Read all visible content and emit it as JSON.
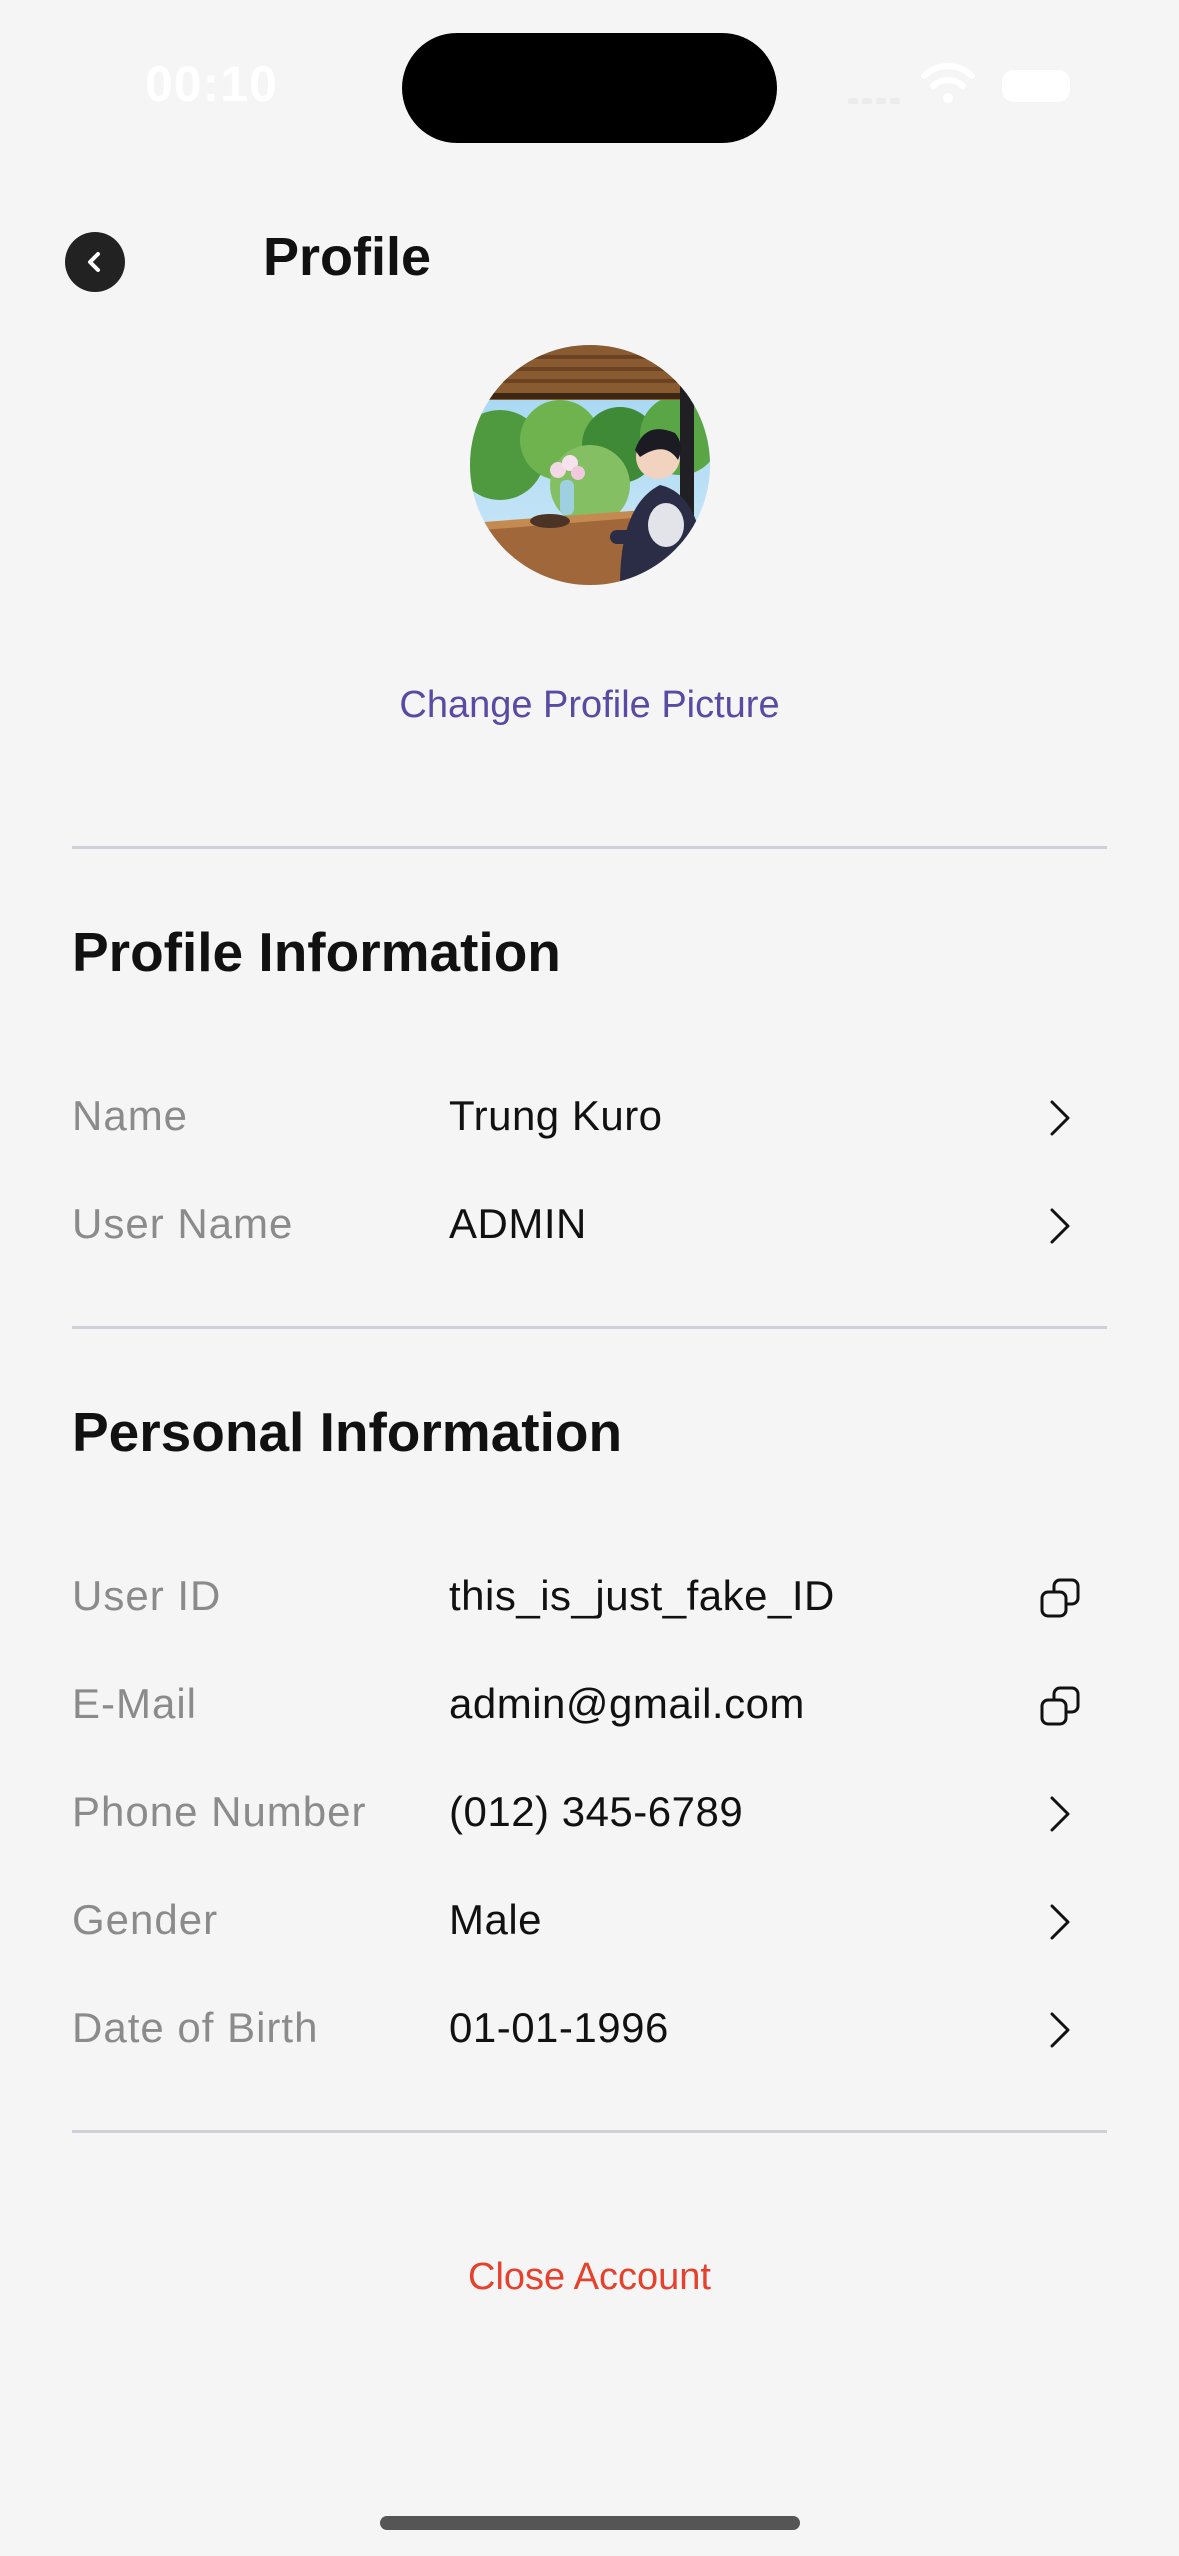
{
  "status_bar": {
    "time": "00:10"
  },
  "header": {
    "title": "Profile"
  },
  "avatar": {
    "change_label": "Change Profile Picture"
  },
  "profile_section": {
    "title": "Profile Information",
    "rows": [
      {
        "label": "Name",
        "value": "Trung Kuro",
        "action_icon": "chevron-right-icon"
      },
      {
        "label": "User Name",
        "value": "ADMIN",
        "action_icon": "chevron-right-icon"
      }
    ]
  },
  "personal_section": {
    "title": "Personal Information",
    "rows": [
      {
        "label": "User ID",
        "value": "this_is_just_fake_ID",
        "action_icon": "copy-icon"
      },
      {
        "label": "E-Mail",
        "value": "admin@gmail.com",
        "action_icon": "copy-icon"
      },
      {
        "label": "Phone Number",
        "value": "(012) 345-6789",
        "action_icon": "chevron-right-icon"
      },
      {
        "label": "Gender",
        "value": "Male",
        "action_icon": "chevron-right-icon"
      },
      {
        "label": "Date of Birth",
        "value": "01-01-1996",
        "action_icon": "chevron-right-icon"
      }
    ]
  },
  "footer": {
    "close_account_label": "Close Account"
  },
  "colors": {
    "background": "#f5f5f5",
    "link_purple": "#5a4aa3",
    "danger_red": "#e5412d",
    "label_gray": "#8b8b8b"
  }
}
